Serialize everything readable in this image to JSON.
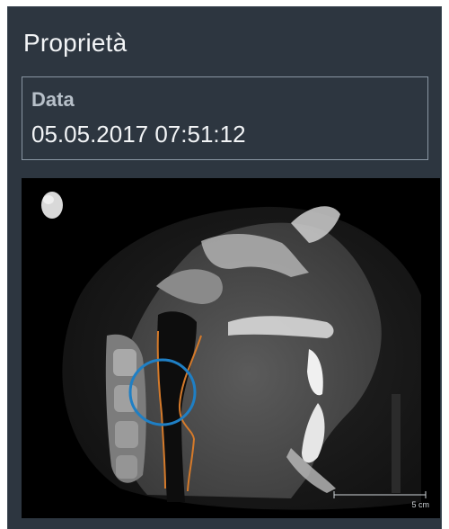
{
  "panel": {
    "title": "Proprietà",
    "date_field": {
      "label": "Data",
      "value": "05.05.2017 07:51:12"
    }
  },
  "viewer": {
    "orientation_icon": "head-orientation-icon",
    "scale_bar_label": "5 cm",
    "airway_outline_color": "#d57a2a",
    "roi_circle_color": "#1f7fc4"
  }
}
